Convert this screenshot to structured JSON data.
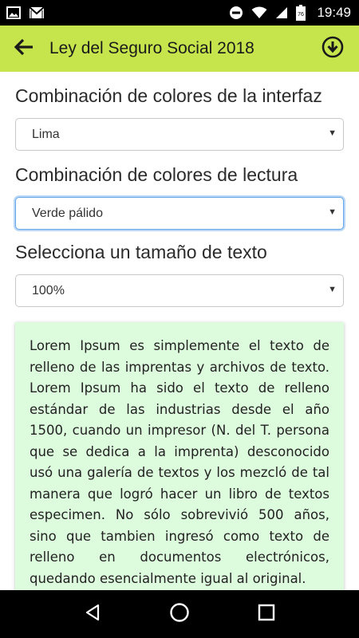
{
  "status_bar": {
    "time": "19:49",
    "icons": [
      "image-icon",
      "gmail-icon",
      "do-not-disturb-icon",
      "wifi-icon",
      "signal-icon",
      "battery-icon"
    ],
    "battery_level": "76"
  },
  "app_bar": {
    "title": "Ley del Seguro Social 2018",
    "back_icon": "arrow-back-icon",
    "action_icon": "download-circle-icon",
    "color": "#c6e54d"
  },
  "settings": {
    "interface_label": "Combinación de colores de la interfaz",
    "interface_value": "Lima",
    "reading_label": "Combinación de colores de lectura",
    "reading_value": "Verde pálido",
    "size_label": "Selecciona un tamaño de texto",
    "size_value": "100%"
  },
  "preview": {
    "text": "Lorem Ipsum es simplemente el texto de relleno de las imprentas y archivos de texto. Lorem Ipsum ha sido el texto de relleno estándar de las industrias desde el año 1500, cuando un impresor (N. del T. persona que se dedica a la imprenta) desconocido usó una galería de textos y los mezcló de tal manera que logró hacer un libro de textos especimen. No sólo sobrevivió 500 años, sino que tambien ingresó como texto de relleno en documentos electrónicos, quedando esencialmente igual al original.",
    "background": "#ddfbdd"
  },
  "nav_bar": {
    "buttons": [
      "back-triangle-icon",
      "home-circle-icon",
      "recents-square-icon"
    ]
  }
}
